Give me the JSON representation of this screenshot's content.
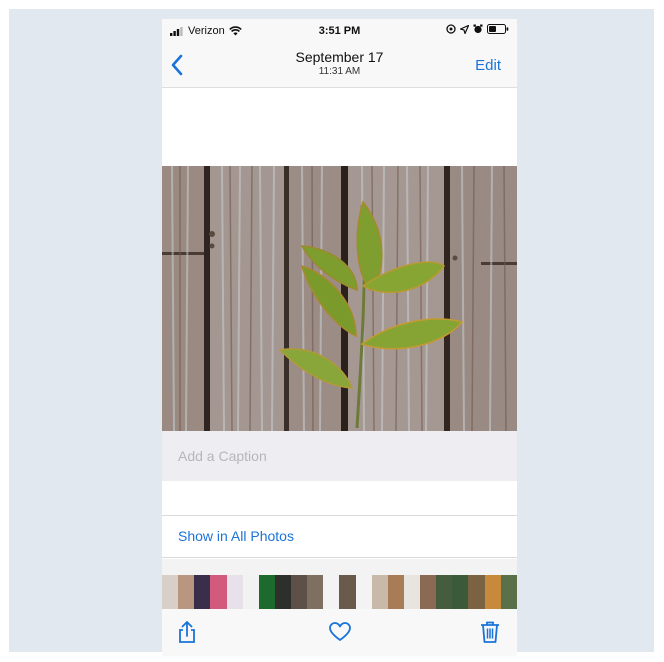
{
  "status_bar": {
    "carrier": "Verizon",
    "time": "3:51 PM"
  },
  "nav": {
    "date": "September 17",
    "time": "11:31 AM",
    "edit_label": "Edit"
  },
  "caption": {
    "placeholder": "Add a Caption"
  },
  "links": {
    "show_all_label": "Show in All Photos"
  },
  "thumbnails": [
    "#d8cfc8",
    "#b89680",
    "#3a2f4a",
    "#d25a7c",
    "#e8e0ea",
    "#f2f2f2",
    "#1c6a2e",
    "#2c2f2c",
    "#5d5046",
    "#7f6f60",
    "#f3f3f3",
    "#6a5a4b",
    "#f3f3f3",
    "#c9b9a8",
    "#a87c56",
    "#e8e4e0",
    "#8a6a52",
    "#465c3e",
    "#3b5a3a",
    "#7a6242",
    "#c78a3c",
    "#5a7048"
  ],
  "colors": {
    "accent": "#1a73d9"
  },
  "icons": {
    "back": "chevron-left-icon",
    "share": "share-icon",
    "favorite": "heart-icon",
    "delete": "trash-icon"
  }
}
